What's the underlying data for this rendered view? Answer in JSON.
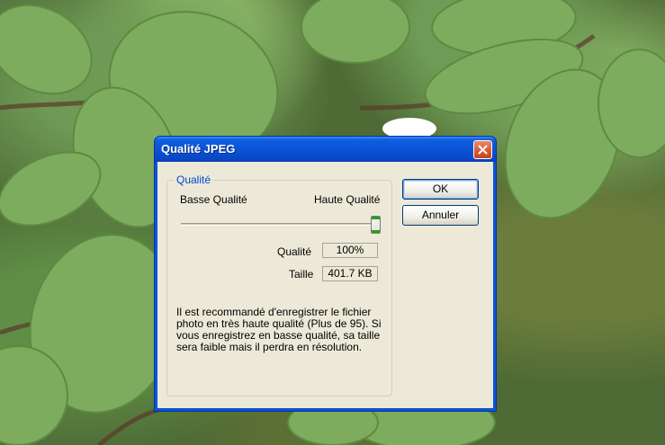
{
  "window": {
    "title": "Qualité JPEG",
    "close_icon": "close-x-icon"
  },
  "group": {
    "legend": "Qualité",
    "low_label": "Basse Qualité",
    "high_label": "Haute Qualité",
    "slider_value_percent": 100
  },
  "readouts": {
    "quality_label": "Qualité",
    "quality_value": "100%",
    "size_label": "Taille",
    "size_value": "401.7 KB"
  },
  "description": "Il est recommandé d'enregistrer le fichier photo en très haute qualité (Plus de 95). Si vous enregistrez en basse qualité, sa taille sera faible mais il perdra en résolution.",
  "buttons": {
    "ok": "OK",
    "cancel": "Annuler"
  },
  "colors": {
    "titlebar": "#0a54d8",
    "legend": "#0046d5",
    "close": "#d7562f"
  }
}
